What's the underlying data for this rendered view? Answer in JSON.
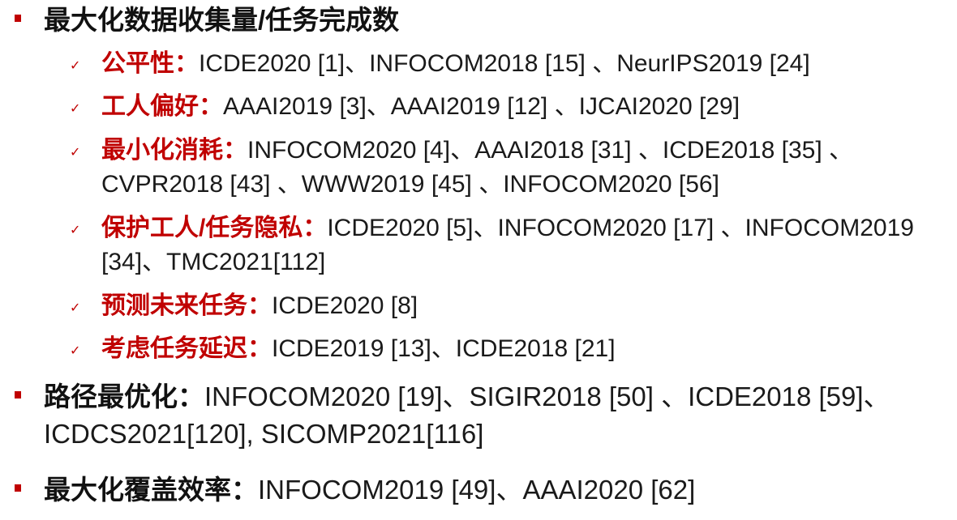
{
  "colors": {
    "accent": "#c00000",
    "text": "#1a1a1a"
  },
  "sections": [
    {
      "label": "最大化数据收集量/任务完成数",
      "refs": "",
      "sub": [
        {
          "label": "公平性：",
          "refs": "ICDE2020 [1]、INFOCOM2018 [15] 、NeurIPS2019 [24]"
        },
        {
          "label": "工人偏好：",
          "refs": "AAAI2019 [3]、AAAI2019 [12] 、IJCAI2020 [29]"
        },
        {
          "label": "最小化消耗：",
          "refs": "INFOCOM2020 [4]、AAAI2018 [31] 、ICDE2018 [35] 、CVPR2018 [43] 、WWW2019 [45] 、INFOCOM2020 [56]"
        },
        {
          "label": "保护工人/任务隐私：",
          "refs": "ICDE2020 [5]、INFOCOM2020 [17] 、INFOCOM2019 [34]、TMC2021[112]"
        },
        {
          "label": "预测未来任务：",
          "refs": "ICDE2020 [8]"
        },
        {
          "label": "考虑任务延迟：",
          "refs": "ICDE2019 [13]、ICDE2018 [21]"
        }
      ]
    },
    {
      "label": "路径最优化：",
      "refs": "INFOCOM2020 [19]、SIGIR2018 [50] 、ICDE2018 [59]、ICDCS2021[120], SICOMP2021[116]"
    },
    {
      "label": "最大化覆盖效率：",
      "refs": "INFOCOM2019 [49]、AAAI2020 [62]"
    }
  ]
}
